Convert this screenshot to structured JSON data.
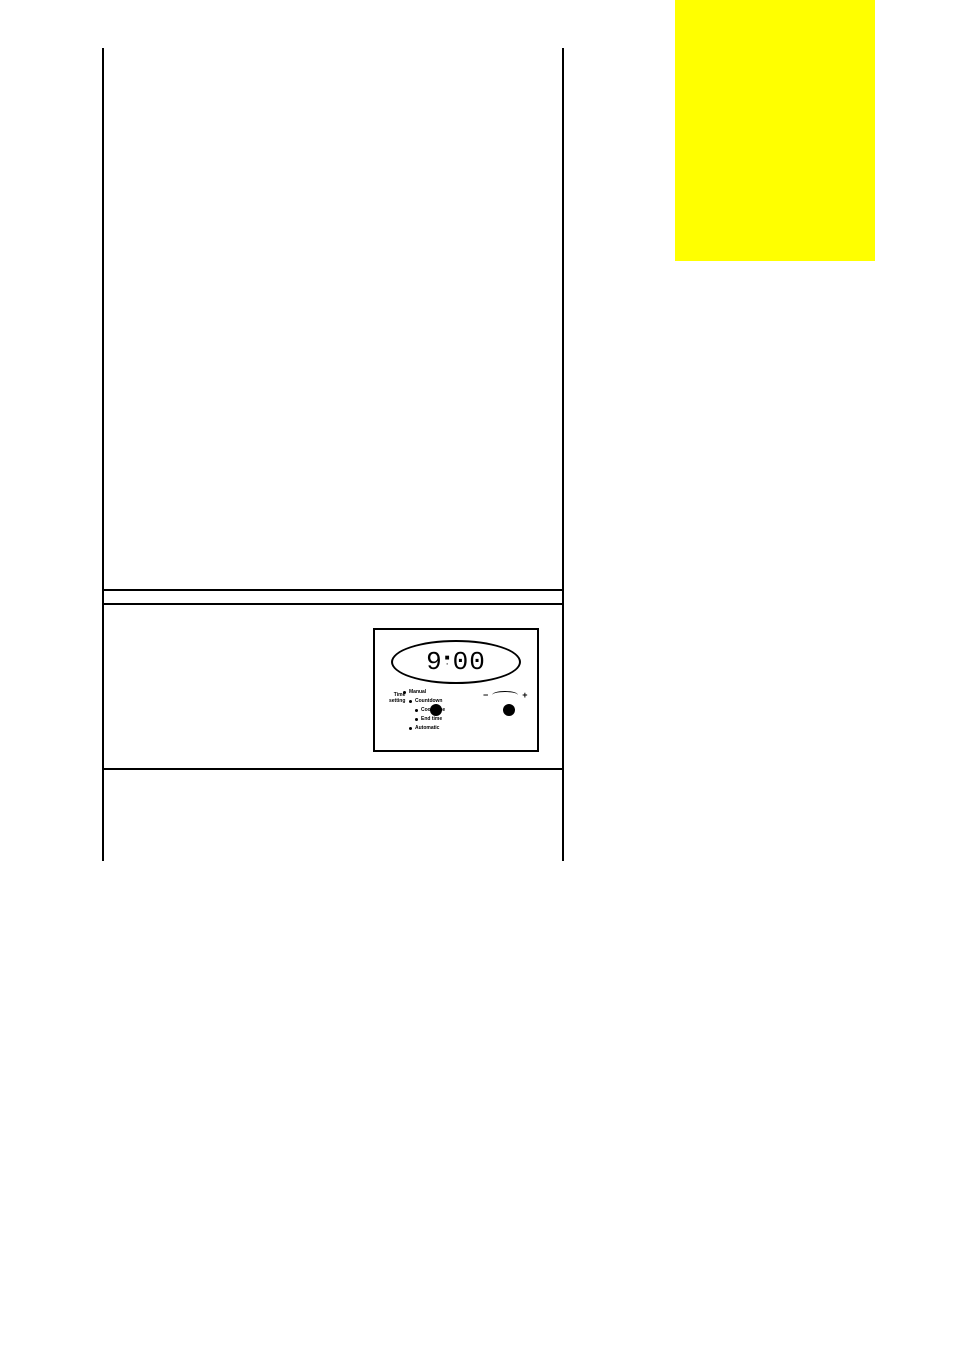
{
  "yellowTab": {},
  "clockPanel": {
    "time": "9:00",
    "timeSettingLabel": "Time\nsetting",
    "labels": {
      "manual": "Manual",
      "countdown": "Countdown",
      "cookTime": "Cook time",
      "endTime": "End time",
      "automatic": "Automatic"
    },
    "controls": {
      "minus": "−",
      "plus": "+"
    }
  }
}
